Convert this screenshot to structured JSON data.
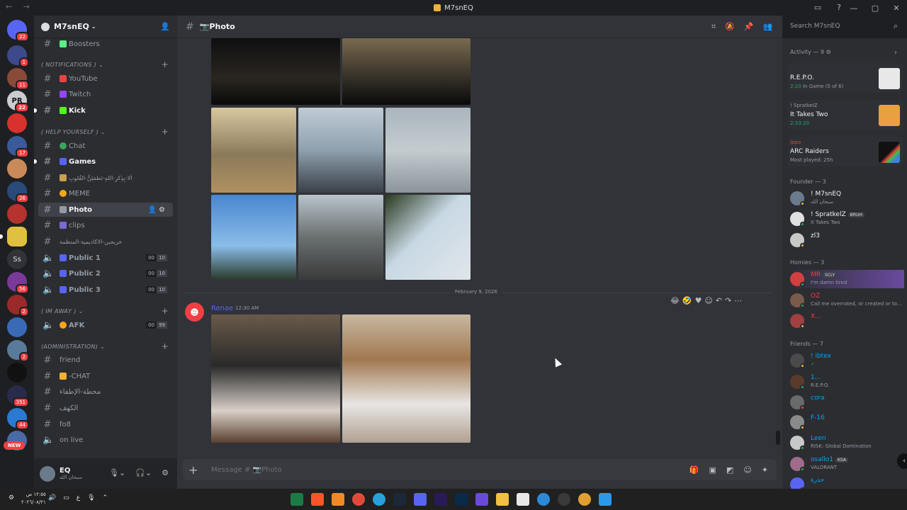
{
  "window": {
    "title": "M7snEQ"
  },
  "server": {
    "name": "M7snEQ"
  },
  "channels": [
    {
      "name": "Boosters",
      "emoji_color": "#57f287"
    },
    {
      "category": "( NOTIFICATIONS )"
    },
    {
      "name": "YouTube",
      "emoji_color": "#ed4245"
    },
    {
      "name": "Twitch",
      "emoji_color": "#9146ff"
    },
    {
      "name": "Kick",
      "emoji_color": "#53fc18"
    },
    {
      "category": "( HELP YOURSELF )"
    },
    {
      "name": "Chat",
      "emoji_color": "#3ba55c"
    },
    {
      "name": "Games",
      "emoji_color": "#5865f2"
    },
    {
      "name": "اَلا-بِذِكرِ-اللهِ-تَطمَئِنُّ-القُلوبِ"
    },
    {
      "name": "MEME",
      "emoji_color": "#faa61a"
    },
    {
      "name": "Photo"
    },
    {
      "name": "clips"
    },
    {
      "name": "خريجين-الاكاديمية-المنظمة"
    },
    {
      "name": "Public 1",
      "voice": [
        "00",
        "10"
      ]
    },
    {
      "name": "Public 2",
      "voice": [
        "00",
        "10"
      ]
    },
    {
      "name": "Public 3",
      "voice": [
        "00",
        "10"
      ]
    },
    {
      "category": "( IM AWAY )"
    },
    {
      "name": "AFK",
      "voice": [
        "00",
        "99"
      ]
    },
    {
      "category": "(ADMINISTRATION)"
    },
    {
      "name": "friend"
    },
    {
      "name": "-CHAT"
    },
    {
      "name": "محطة-الإطفاء"
    },
    {
      "name": "الكهف"
    },
    {
      "name": "fo8"
    },
    {
      "name": "on live"
    }
  ],
  "guild_badges": [
    "22",
    "1",
    "11",
    "22",
    "17",
    "26",
    "56",
    "2",
    "2",
    "351",
    "44"
  ],
  "guild_labels": {
    "ss": "Ss",
    "pr": "PR"
  },
  "new_label": "NEW",
  "user": {
    "name": "EQ",
    "status": "سبحان الله"
  },
  "channel_header": {
    "name": "📷Photo"
  },
  "search": {
    "placeholder": "Search M7snEQ"
  },
  "message": {
    "date": "February 9, 2026",
    "author": "Renae",
    "time": "12:30 AM"
  },
  "composer": {
    "placeholder": "Message # 📷Photo"
  },
  "members": {
    "activity_header": "Activity — 9",
    "activities": [
      {
        "who": "",
        "game": "R.E.P.O.",
        "sub": "2:20",
        "extra": "In Game (5 of 6)"
      },
      {
        "who": "! SpratkelZ",
        "game": "It Takes Two",
        "sub": "2:33:20"
      },
      {
        "who": "ippo",
        "game": "ARC Raiders",
        "sub": "Most played: 25h"
      }
    ],
    "groups": [
      {
        "header": "Founder — 3",
        "members": [
          {
            "name": "! M7snEQ",
            "status": "سبحان الله",
            "color": "#f2f3f5"
          },
          {
            "name": "! SpratkelZ",
            "status": "It Takes Two",
            "color": "#f2f3f5",
            "tag": "BRUH"
          },
          {
            "name": "zl3",
            "status": "",
            "color": "#f2f3f5"
          }
        ]
      },
      {
        "header": "Homies — 3",
        "members": [
          {
            "name": "MR",
            "status": "I'm damn tired",
            "color": "#f23f43",
            "tag": "SCLY"
          },
          {
            "name": "OZ",
            "status": "Call me overrated, or created or to...",
            "color": "#f23f43"
          },
          {
            "name": "X...",
            "status": "",
            "color": "#f23f43"
          }
        ]
      },
      {
        "header": "Friends — 7",
        "members": [
          {
            "name": "! ibtex",
            "status": "",
            "color": "#00a8fc"
          },
          {
            "name": "1...",
            "status": "R.E.P.O.",
            "color": "#00a8fc"
          },
          {
            "name": "cora",
            "status": "",
            "color": "#00a8fc"
          },
          {
            "name": "F-16",
            "status": "",
            "color": "#00a8fc"
          },
          {
            "name": "Leen",
            "status": "RISK: Global Domination",
            "color": "#00a8fc"
          },
          {
            "name": "osallo1",
            "status": "VALORANT",
            "color": "#00a8fc",
            "tag": "KSA"
          },
          {
            "name": "حذرة",
            "status": "",
            "color": "#00a8fc"
          }
        ]
      }
    ]
  },
  "taskbar": {
    "clock_time": "١٢:٥٥ ص",
    "clock_date": "٢٠٢٦/٠٨/٢١"
  },
  "colors": {
    "accent": "#5865f2",
    "danger": "#f23f43",
    "online": "#23a55a",
    "idle": "#f0b232"
  }
}
